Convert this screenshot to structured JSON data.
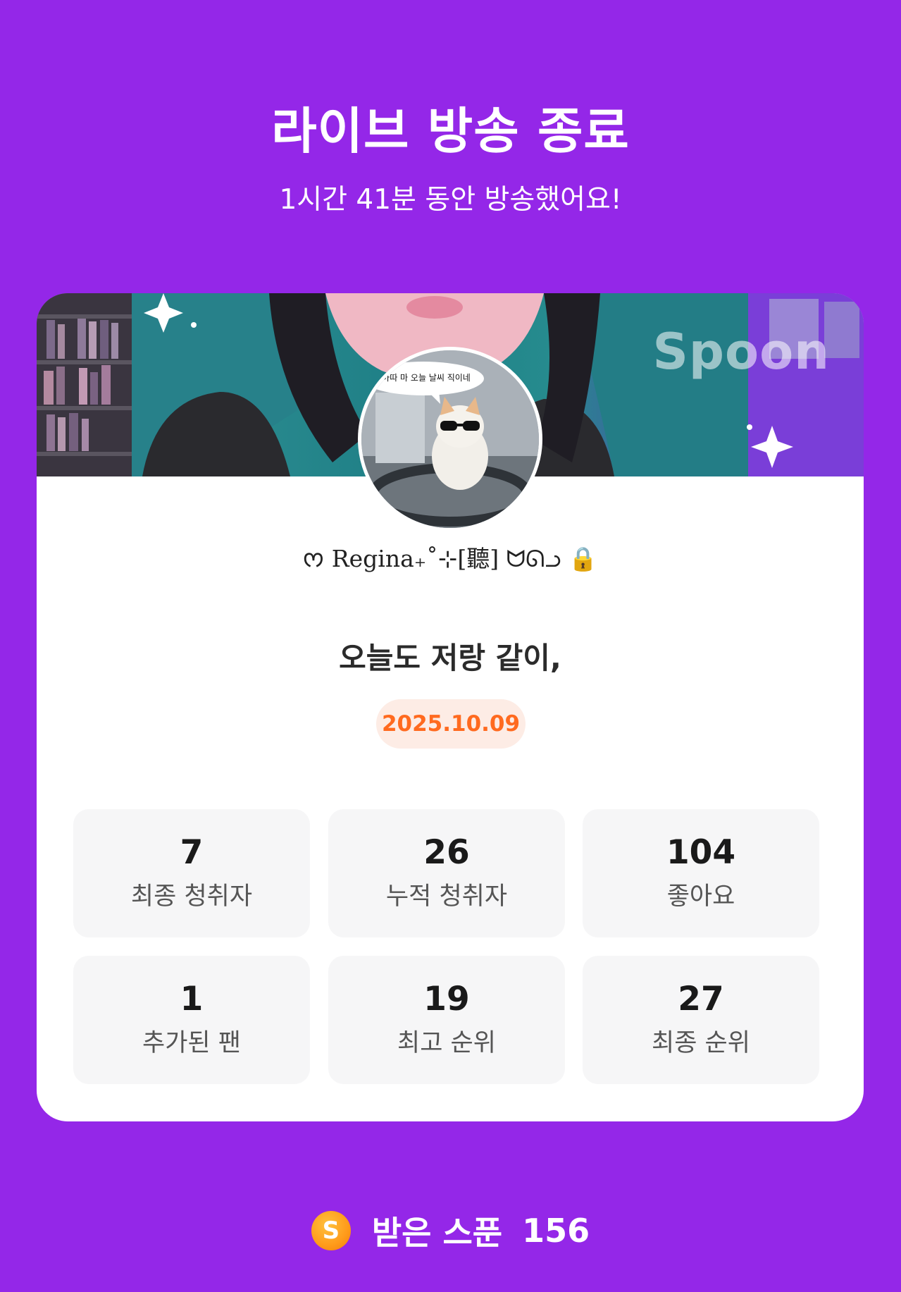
{
  "header": {
    "title": "라이브 방송 종료",
    "subtitle": "1시간 41분 동안 방송했어요!"
  },
  "card": {
    "banner": {
      "watermark": "Spoon"
    },
    "avatar": {
      "speech_bubble": "아따 마 오늘 날씨 직이네"
    },
    "nickname": "ᰔ Regina₊˚⊹[聽] ᗢᘏᓗ 🔒",
    "live_title": "오늘도 저랑 같이,",
    "date": "2025.10.09",
    "stats": [
      {
        "value": "7",
        "label": "최종 청취자"
      },
      {
        "value": "26",
        "label": "누적 청취자"
      },
      {
        "value": "104",
        "label": "좋아요"
      },
      {
        "value": "1",
        "label": "추가된 팬"
      },
      {
        "value": "19",
        "label": "최고 순위"
      },
      {
        "value": "27",
        "label": "최종 순위"
      }
    ]
  },
  "footer": {
    "coin_symbol": "S",
    "label": "받은 스푼",
    "value": "156"
  },
  "colors": {
    "background": "#9427e8",
    "card": "#ffffff",
    "date_text": "#ff6a1f",
    "date_pill": "#fdece5",
    "stat_box": "#f6f6f7",
    "coin": "#ff9a1a"
  },
  "icons": {
    "coin": "spoon-coin-icon",
    "lock": "lock-icon"
  }
}
